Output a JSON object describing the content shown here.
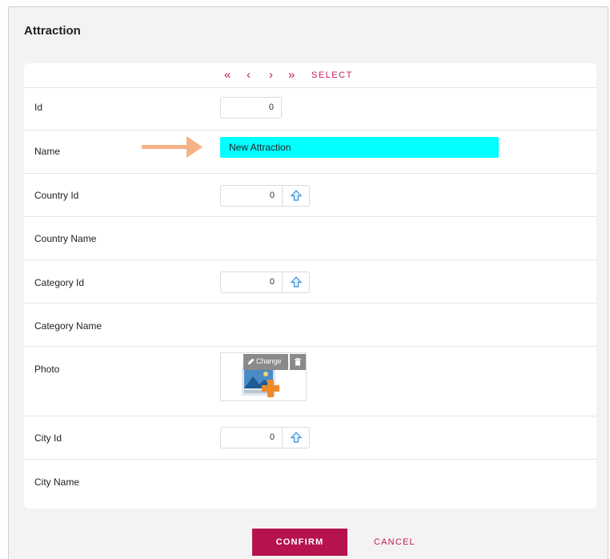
{
  "window": {
    "title": "Attraction"
  },
  "nav": {
    "first_icon": "double-chevron-left-icon",
    "prev_icon": "chevron-left-icon",
    "next_icon": "chevron-right-icon",
    "last_icon": "double-chevron-right-icon",
    "select_label": "SELECT"
  },
  "fields": {
    "id": {
      "label": "Id",
      "value": "0"
    },
    "name": {
      "label": "Name",
      "value": "New Attraction",
      "highlight_color": "#00ffff",
      "arrow_color": "#f4b183"
    },
    "country_id": {
      "label": "Country Id",
      "value": "0",
      "prompt_icon": "arrow-up-icon"
    },
    "country_name": {
      "label": "Country Name"
    },
    "category_id": {
      "label": "Category Id",
      "value": "0",
      "prompt_icon": "arrow-up-icon"
    },
    "category_name": {
      "label": "Category Name"
    },
    "photo": {
      "label": "Photo",
      "change_label": "Change",
      "change_icon": "pencil-icon",
      "delete_icon": "trash-icon",
      "thumbnail_icon": "add-image-icon"
    },
    "city_id": {
      "label": "City Id",
      "value": "0",
      "prompt_icon": "arrow-up-icon"
    },
    "city_name": {
      "label": "City Name"
    }
  },
  "actions": {
    "confirm_label": "CONFIRM",
    "cancel_label": "CANCEL"
  },
  "colors": {
    "accent": "#c2185b",
    "confirm_bg": "#b5124f",
    "panel_bg": "#f3f3f3"
  }
}
